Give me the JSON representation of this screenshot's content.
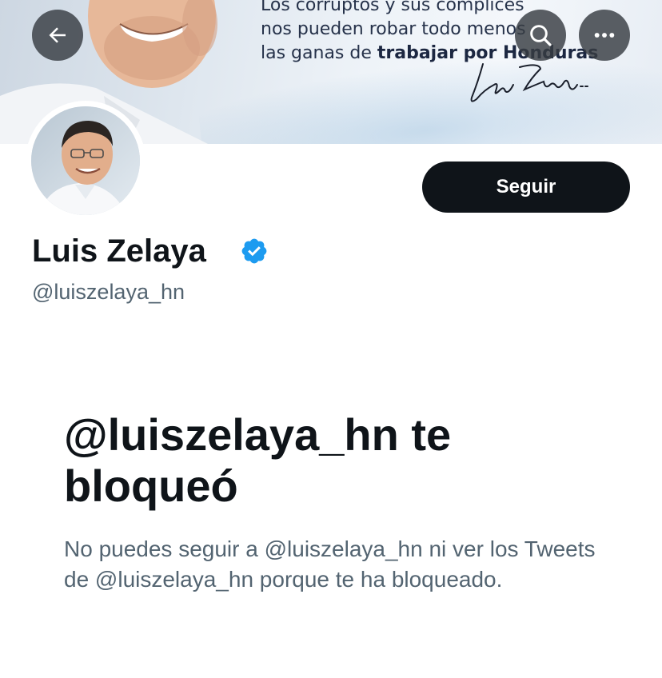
{
  "header": {
    "banner_slogan_line1": "Los corruptos y sus cómplices",
    "banner_slogan_line2": "nos pueden robar todo menos",
    "banner_slogan_line3_prefix": "las ganas de ",
    "banner_slogan_line3_bold": "trabajar por Honduras",
    "back_icon": "arrow-left-icon",
    "search_icon": "search-icon",
    "more_icon": "more-horizontal-icon"
  },
  "profile": {
    "display_name": "Luis Zelaya",
    "handle": "@luiszelaya_hn",
    "verified": true,
    "follow_label": "Seguir"
  },
  "blocked": {
    "title": "@luiszelaya_hn te bloqueó",
    "message": "No puedes seguir a @luiszelaya_hn ni ver los Tweets de @luiszelaya_hn porque te ha bloqueado."
  },
  "colors": {
    "primary_text": "#0f1419",
    "secondary_text": "#536471",
    "verified_blue": "#1d9bf0",
    "button_bg": "#0f1419"
  }
}
